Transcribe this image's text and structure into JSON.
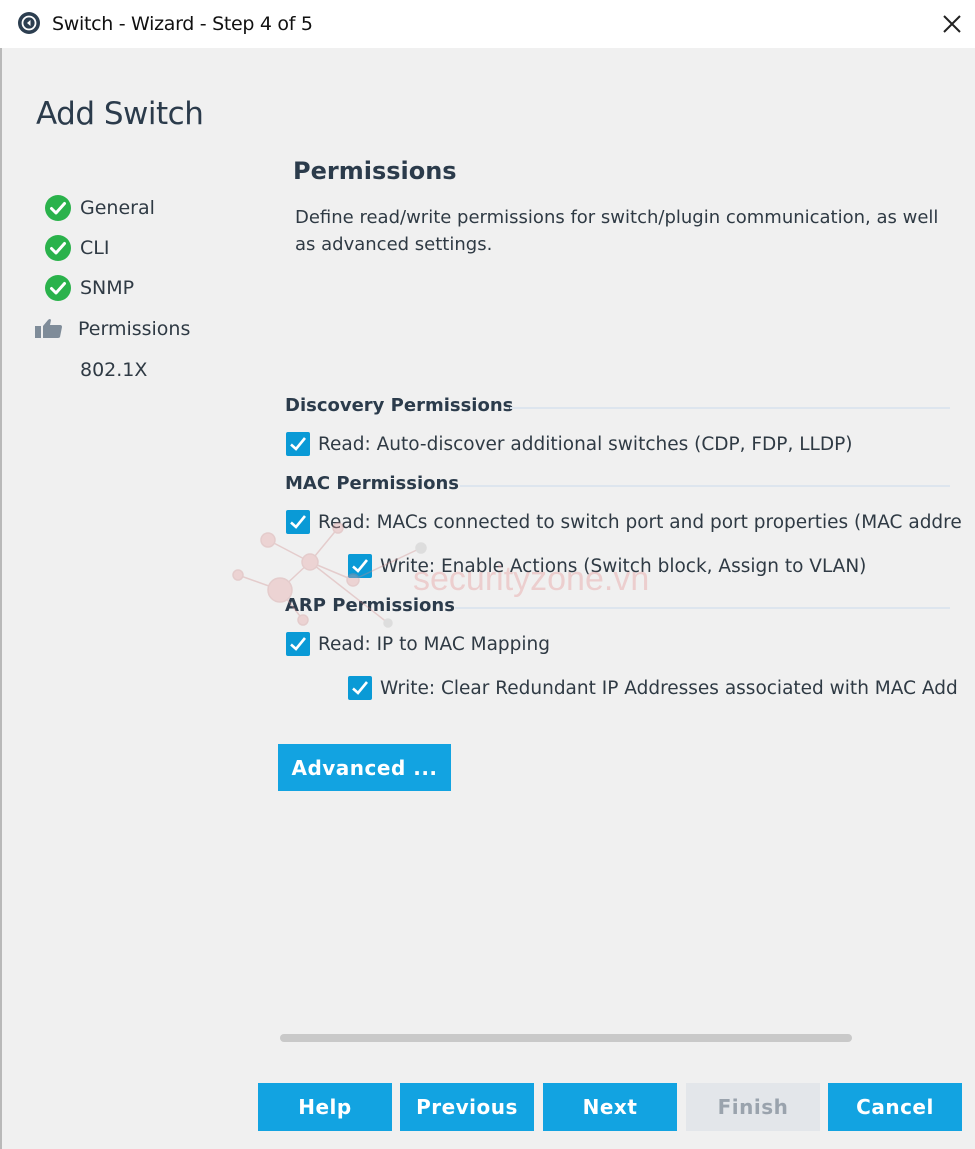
{
  "window": {
    "title": "Switch - Wizard - Step 4 of 5"
  },
  "page_title": "Add Switch",
  "steps": [
    {
      "label": "General",
      "state": "done"
    },
    {
      "label": "CLI",
      "state": "done"
    },
    {
      "label": "SNMP",
      "state": "done"
    },
    {
      "label": "Permissions",
      "state": "current"
    },
    {
      "label": "802.1X",
      "state": "pending"
    }
  ],
  "section": {
    "title": "Permissions",
    "description": "Define read/write permissions for switch/plugin communication, as well as advanced settings."
  },
  "groups": {
    "discovery": {
      "title": "Discovery Permissions",
      "read_label": "Read: Auto-discover additional switches (CDP, FDP, LLDP)",
      "read_checked": true
    },
    "mac": {
      "title": "MAC Permissions",
      "read_label": "Read: MACs connected to switch port and port properties (MAC addres",
      "read_checked": true,
      "write_label": "Write: Enable Actions (Switch block, Assign to VLAN)",
      "write_checked": true
    },
    "arp": {
      "title": "ARP Permissions",
      "read_label": "Read: IP to MAC Mapping",
      "read_checked": true,
      "write_label": "Write: Clear Redundant IP Addresses associated with MAC Add",
      "write_checked": true
    }
  },
  "advanced_label": "Advanced ...",
  "footer": {
    "help": "Help",
    "previous": "Previous",
    "next": "Next",
    "finish": "Finish",
    "cancel": "Cancel"
  },
  "watermark": "securityzone.vn",
  "colors": {
    "accent": "#12a3e1",
    "check_green": "#2ab24b",
    "disabled_bg": "#e3e6ea"
  }
}
